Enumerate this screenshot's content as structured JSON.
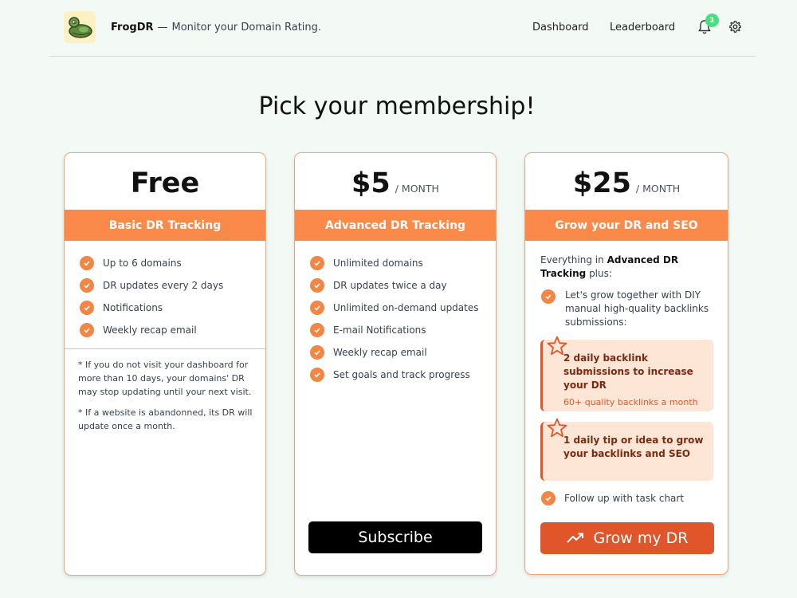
{
  "app": {
    "name": "FrogDR",
    "separator": "—",
    "tagline": "Monitor your Domain Rating."
  },
  "nav": {
    "dashboard": "Dashboard",
    "leaderboard": "Leaderboard",
    "notification_count": "1",
    "icons": [
      "bell-icon",
      "gear-icon"
    ]
  },
  "page": {
    "title": "Pick your membership!"
  },
  "colors": {
    "accent": "#fb8a4a",
    "accent_dark": "#e0552a",
    "badge": "#4ade80",
    "background": "#f3faf5"
  },
  "plans": {
    "free": {
      "price": "Free",
      "name": "Basic DR Tracking",
      "features": [
        "Up to 6 domains",
        "DR updates every 2 days",
        "Notifications",
        "Weekly recap email"
      ],
      "notes": [
        "* If you do not visit your dashboard for more than 10 days, your domains' DR may stop updating until your next visit.",
        "* If a website is abandonned, its DR will update once a month."
      ]
    },
    "advanced": {
      "price": "$5",
      "period": "/ MONTH",
      "name": "Advanced DR Tracking",
      "features": [
        "Unlimited domains",
        "DR updates twice a day",
        "Unlimited on-demand updates",
        "E-mail Notifications",
        "Weekly recap email",
        "Set goals and track progress"
      ],
      "cta": "Subscribe"
    },
    "grow": {
      "price": "$25",
      "period": "/ MONTH",
      "name": "Grow your DR and SEO",
      "intro_prefix": "Everything in",
      "intro_bold": "Advanced DR Tracking",
      "intro_suffix": "plus:",
      "diy": "Let's grow together with DIY manual high-quality backlinks submissions:",
      "perks": [
        {
          "title": "2 daily backlink submissions to increase your DR",
          "subtitle": "60+ quality backlinks a month"
        },
        {
          "title": "1 daily tip or idea to grow your backlinks and SEO"
        }
      ],
      "followup": "Follow up with task chart",
      "cta": "Grow my DR"
    }
  }
}
